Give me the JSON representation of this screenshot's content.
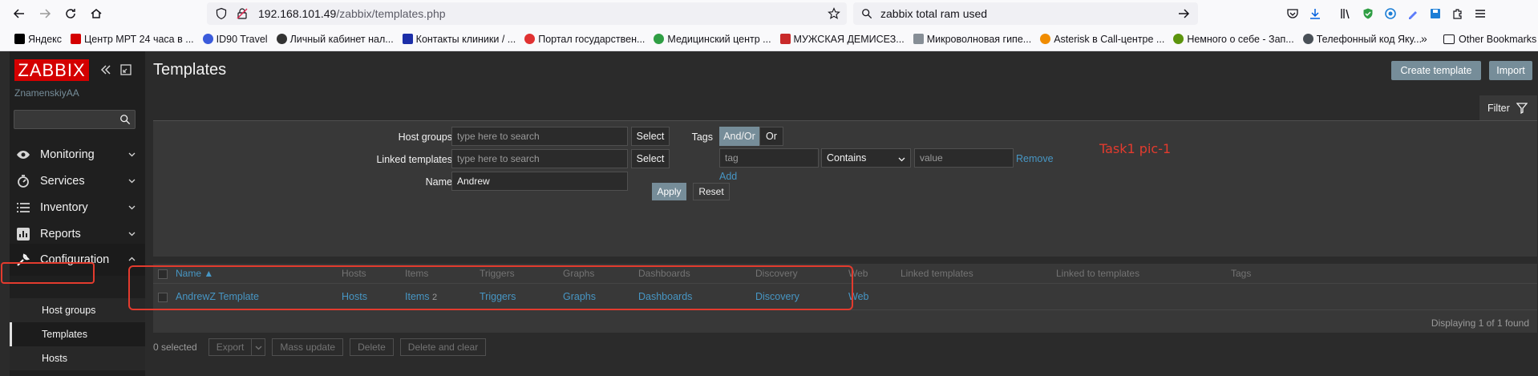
{
  "browser": {
    "url_host": "192.168.101.49",
    "url_path": "/zabbix/templates.php",
    "search_query": "zabbix total ram used",
    "bookmarks": [
      {
        "label": "Яндекс",
        "color": "#000000"
      },
      {
        "label": "Центр МРТ 24 часа в ...",
        "color": "#d40000"
      },
      {
        "label": "ID90 Travel",
        "color": "#3b5bdb"
      },
      {
        "label": "Личный кабинет нал...",
        "color": "#333333"
      },
      {
        "label": "Контакты клиники / ...",
        "color": "#1c2ea8"
      },
      {
        "label": "Портал государствен...",
        "color": "#e03131"
      },
      {
        "label": "Медицинский центр ...",
        "color": "#2f9e44"
      },
      {
        "label": "МУЖСКАЯ ДЕМИСЕЗ...",
        "color": "#c92a2a"
      },
      {
        "label": "Микроволновая гипе...",
        "color": "#868e96"
      },
      {
        "label": "Asterisk в Call-центре ...",
        "color": "#f08c00"
      },
      {
        "label": "Немного о себе - Зап...",
        "color": "#5c940d"
      },
      {
        "label": "Телефонный код Яку...",
        "color": "#495057"
      }
    ],
    "other_bookmarks": "Other Bookmarks"
  },
  "sidebar": {
    "logo": "ZABBIX",
    "user": "ZnamenskiyAA",
    "menu": [
      {
        "label": "Monitoring"
      },
      {
        "label": "Services"
      },
      {
        "label": "Inventory"
      },
      {
        "label": "Reports"
      },
      {
        "label": "Configuration"
      }
    ],
    "submenu": [
      {
        "label": "Host groups"
      },
      {
        "label": "Templates"
      },
      {
        "label": "Hosts"
      }
    ]
  },
  "page": {
    "title": "Templates",
    "create_button": "Create template",
    "import_button": "Import",
    "filter_tab": "Filter"
  },
  "filter": {
    "host_groups_label": "Host groups",
    "host_groups_placeholder": "type here to search",
    "linked_templates_label": "Linked templates",
    "linked_templates_placeholder": "type here to search",
    "select_label": "Select",
    "name_label": "Name",
    "name_value": "Andrew",
    "tags_label": "Tags",
    "and_or": "And/Or",
    "or": "Or",
    "tag_placeholder": "tag",
    "operator": "Contains",
    "value_placeholder": "value",
    "remove": "Remove",
    "add": "Add",
    "apply": "Apply",
    "reset": "Reset"
  },
  "annotation": "Task1 pic-1",
  "table": {
    "headers": [
      "Name ▲",
      "Hosts",
      "Items",
      "Triggers",
      "Graphs",
      "Dashboards",
      "Discovery",
      "Web",
      "Linked templates",
      "Linked to templates",
      "Tags"
    ],
    "row": {
      "name": "AndrewZ Template",
      "hosts": "Hosts",
      "items": "Items",
      "items_count": "2",
      "triggers": "Triggers",
      "graphs": "Graphs",
      "dashboards": "Dashboards",
      "discovery": "Discovery",
      "web": "Web"
    },
    "displaying": "Displaying 1 of 1 found"
  },
  "bottom": {
    "selected": "0 selected",
    "export": "Export",
    "mass_update": "Mass update",
    "delete": "Delete",
    "delete_clear": "Delete and clear"
  }
}
